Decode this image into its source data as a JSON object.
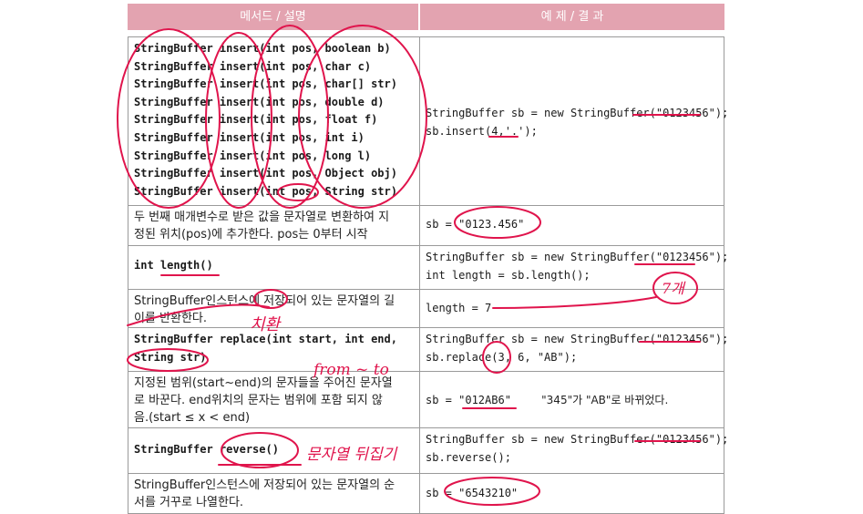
{
  "header": {
    "method_desc": "메서드 / 설명",
    "example_result": "예 제 / 결 과"
  },
  "rows": {
    "insert": {
      "signatures": [
        "StringBuffer insert(int pos, boolean b)",
        "StringBuffer insert(int pos, char c)",
        "StringBuffer insert(int pos, char[] str)",
        "StringBuffer insert(int pos, double d)",
        "StringBuffer insert(int pos, float f)",
        "StringBuffer insert(int pos, int i)",
        "StringBuffer insert(int pos, long l)",
        "StringBuffer insert(int pos, Object obj)",
        "StringBuffer insert(int pos, String str)"
      ],
      "example": [
        "StringBuffer sb = new StringBuffer(\"0123456\");",
        "sb.insert(4,'.');"
      ],
      "desc": [
        "두 번째 매개변수로 받은 값을 문자열로 변환하여 지",
        "정된 위치(pos)에 추가한다. pos는 0부터 시작"
      ],
      "result": "sb = \"0123.456\""
    },
    "length": {
      "signature": "int length()",
      "example": [
        "StringBuffer sb = new StringBuffer(\"0123456\");",
        "int length = sb.length();"
      ],
      "desc": [
        "StringBuffer인스턴스에 저장되어 있는 문자열의 길",
        "이를 반환한다."
      ],
      "result": "length = 7"
    },
    "replace": {
      "signature": [
        "StringBuffer replace(int start, int end,",
        "String str)"
      ],
      "example": [
        "StringBuffer sb = new StringBuffer(\"0123456\");",
        "sb.replace(3, 6, \"AB\");"
      ],
      "desc": [
        "지정된 범위(start~end)의 문자들을 주어진 문자열",
        "로 바꾼다. end위치의 문자는 범위에 포함 되지 않",
        "음.(start ≤ x < end)"
      ],
      "result": "sb = \"012AB6\"",
      "result_note": "\"345\"가 \"AB\"로 바뀌었다."
    },
    "reverse": {
      "signature": "StringBuffer reverse()",
      "example": [
        "StringBuffer sb = new StringBuffer(\"0123456\");",
        "sb.reverse();"
      ],
      "desc": [
        "StringBuffer인스턴스에 저장되어 있는 문자열의 순",
        "서를 거꾸로 나열한다."
      ],
      "result": "sb = \"6543210\""
    }
  },
  "annotations": {
    "count": "7개",
    "replace_word": "치환",
    "range": "from ~ to",
    "reverse_word": "문자열 뒤집기"
  },
  "colors": {
    "header_bg": "#e3a3b0",
    "ink": "#e0144c"
  }
}
